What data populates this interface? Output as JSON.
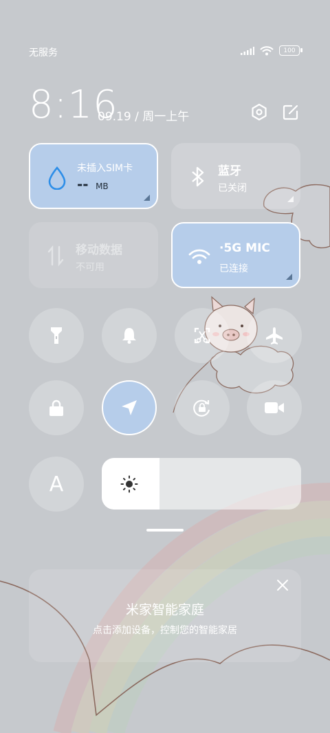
{
  "status_bar": {
    "carrier": "无服务",
    "battery": "100"
  },
  "header": {
    "time": "8:16",
    "date": "09.19 / 周一上午"
  },
  "tiles": {
    "sim": {
      "title": "未插入SIM卡",
      "value": "--",
      "unit": "MB"
    },
    "bluetooth": {
      "title": "蓝牙",
      "status": "已关闭"
    },
    "mobile_data": {
      "title": "移动数据",
      "status": "不可用"
    },
    "wifi": {
      "title": "·5G   MIC",
      "status": "已连接"
    }
  },
  "toggles": [
    {
      "name": "flashlight-icon",
      "active": false
    },
    {
      "name": "bell-icon",
      "active": false
    },
    {
      "name": "screenshot-icon",
      "active": false
    },
    {
      "name": "airplane-icon",
      "active": false
    },
    {
      "name": "lock-icon",
      "active": false
    },
    {
      "name": "location-icon",
      "active": true
    },
    {
      "name": "rotation-lock-icon",
      "active": false
    },
    {
      "name": "video-icon",
      "active": false
    }
  ],
  "auto_brightness_label": "A",
  "brightness": {
    "level": 0.29
  },
  "smart_home": {
    "title": "米家智能家庭",
    "subtitle": "点击添加设备，控制您的智能家居"
  },
  "colors": {
    "active_tile": "#b6cdea",
    "background": "#c6c9cd"
  }
}
